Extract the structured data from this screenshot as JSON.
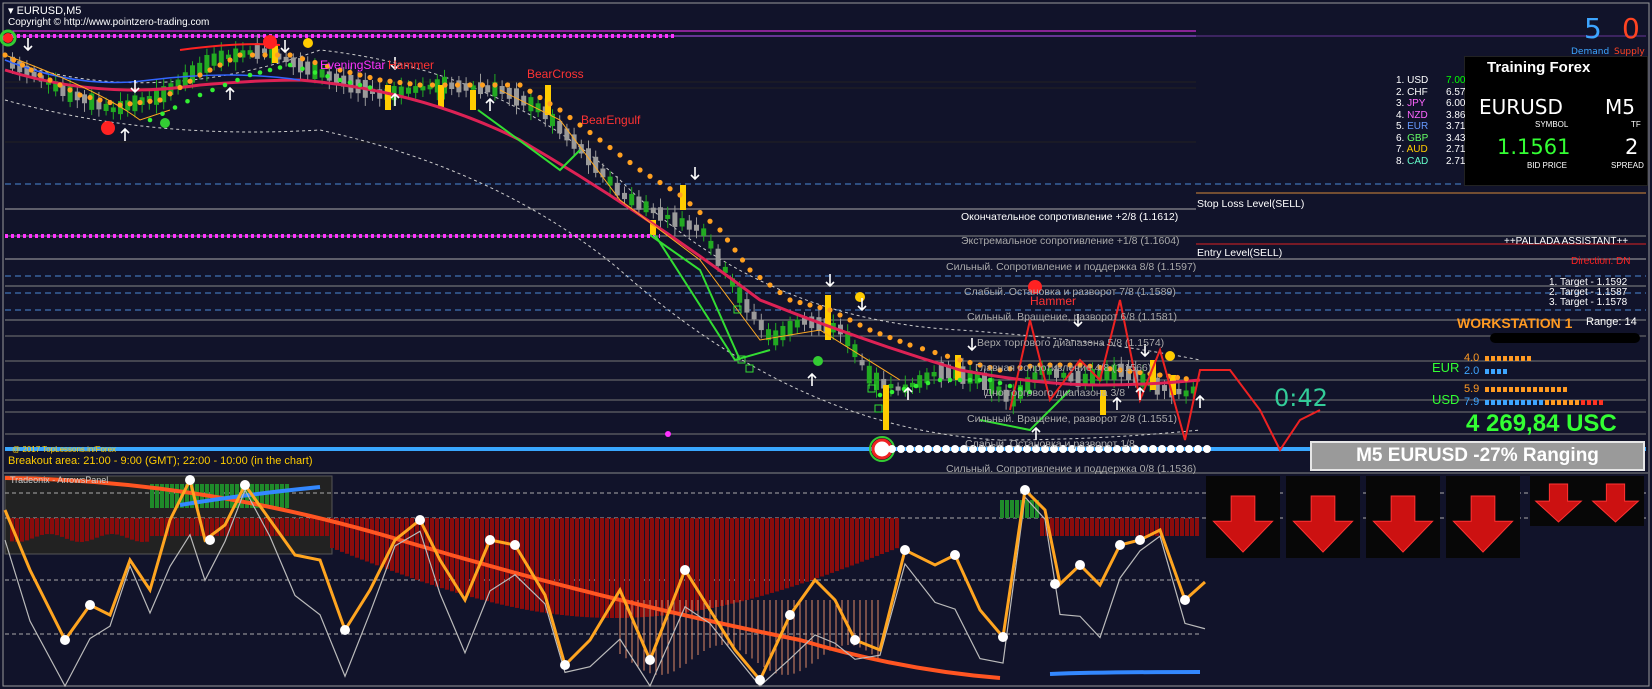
{
  "window": {
    "symbol_tf": "EURUSD,M5",
    "copyright": "Copyright © http://www.pointzero-trading.com"
  },
  "demand_supply": {
    "demand_value": "5",
    "supply_value": "0",
    "demand_label": "Demand",
    "supply_label": "Supply"
  },
  "training_panel": {
    "title": "Training Forex",
    "symbol": "EURUSD",
    "symbol_label": "SYMBOL",
    "tf": "M5",
    "tf_label": "TF",
    "bid": "1.1561",
    "bid_label": "BID PRICE",
    "spread": "2",
    "spread_label": "SPREAD"
  },
  "strength_list": [
    {
      "rank": "1.",
      "cur": "USD",
      "val": "7.00",
      "color": "#ffffff",
      "vcolor": "#00ff00"
    },
    {
      "rank": "2.",
      "cur": "CHF",
      "val": "6.57",
      "color": "#ffffff",
      "vcolor": "#ffffff"
    },
    {
      "rank": "3.",
      "cur": "JPY",
      "val": "6.00",
      "color": "#ff66ff",
      "vcolor": "#ffffff"
    },
    {
      "rank": "4.",
      "cur": "NZD",
      "val": "3.86",
      "color": "#ff66ff",
      "vcolor": "#ffffff"
    },
    {
      "rank": "5.",
      "cur": "EUR",
      "val": "3.71",
      "color": "#6699ff",
      "vcolor": "#ffffff"
    },
    {
      "rank": "6.",
      "cur": "GBP",
      "val": "3.43",
      "color": "#66ff66",
      "vcolor": "#ffffff"
    },
    {
      "rank": "7.",
      "cur": "AUD",
      "val": "2.71",
      "color": "#ffcc00",
      "vcolor": "#ffffff"
    },
    {
      "rank": "8.",
      "cur": "CAD",
      "val": "2.71",
      "color": "#66ffcc",
      "vcolor": "#ffffff"
    }
  ],
  "levels": {
    "stop_loss": "Stop Loss Level(SELL)",
    "entry": "Entry Level(SELL)",
    "l1": "Окончательное сопротивление +2/8  (1.1612)",
    "l2": "Экстремальное сопротивление +1/8  (1.1604)",
    "l3": "Сильный. Сопротивление и поддержка 8/8  (1.1597)",
    "l4": "Слабый. Остановка и разворот 7/8  (1.1589)",
    "l5": "Сильный. Вращение, разворот 6/8  (1.1581)",
    "l6": "Верх торгового диапазона 5/8  (1.1574)",
    "l7": "Главная сопротивление 4/8  (1.1566)",
    "l8": "Дно торгового диапазона 3/8",
    "l9": "Сильный. Вращение, разворот 2/8  (1.1551)",
    "l10": "Слабый. Остановка и разворот 1/8",
    "l11": "Сильный. Сопротивление и поддержка 0/8  (1.1536)"
  },
  "patterns": {
    "p1": "EveningStar",
    "p2": "Hammer",
    "p3": "BearCross",
    "p4": "BearEngulf",
    "p5": "Hammer"
  },
  "assistant": {
    "title": "++PALLADA ASSISTANT++",
    "direction": "Direction: DN",
    "t1": "1. Target - 1.1592",
    "t2": "2. Target - 1.1587",
    "t3": "3. Target - 1.1578"
  },
  "workstation": {
    "title": "WORKSTATION 1",
    "range": "Range: 14",
    "eur_label": "EUR",
    "eur_v1": "4.0",
    "eur_v2": "2.0",
    "usd_label": "USD",
    "usd_v1": "5.9",
    "usd_v2": "7.9"
  },
  "timer": "0:42",
  "balance": "4 269,84 USC",
  "status_banner": "M5 EURUSD  -27% Ranging",
  "breakout": {
    "label": "Breakout area: 21:00 - 9:00 (GMT); 22:00 - 10:00 (in the chart)",
    "credit": "@ 2017 TopLessons.in/Forex"
  },
  "subwindow_title": "Tradeonix - ArrowsPanel",
  "colors": {
    "background": "#11132a",
    "bull": "#22aa22",
    "bear": "#9a9a9a",
    "accent_gold": "#ffcc00",
    "accent_red": "#ff2222",
    "magenta": "#ff33ff",
    "oscillator": "#ffa520"
  }
}
